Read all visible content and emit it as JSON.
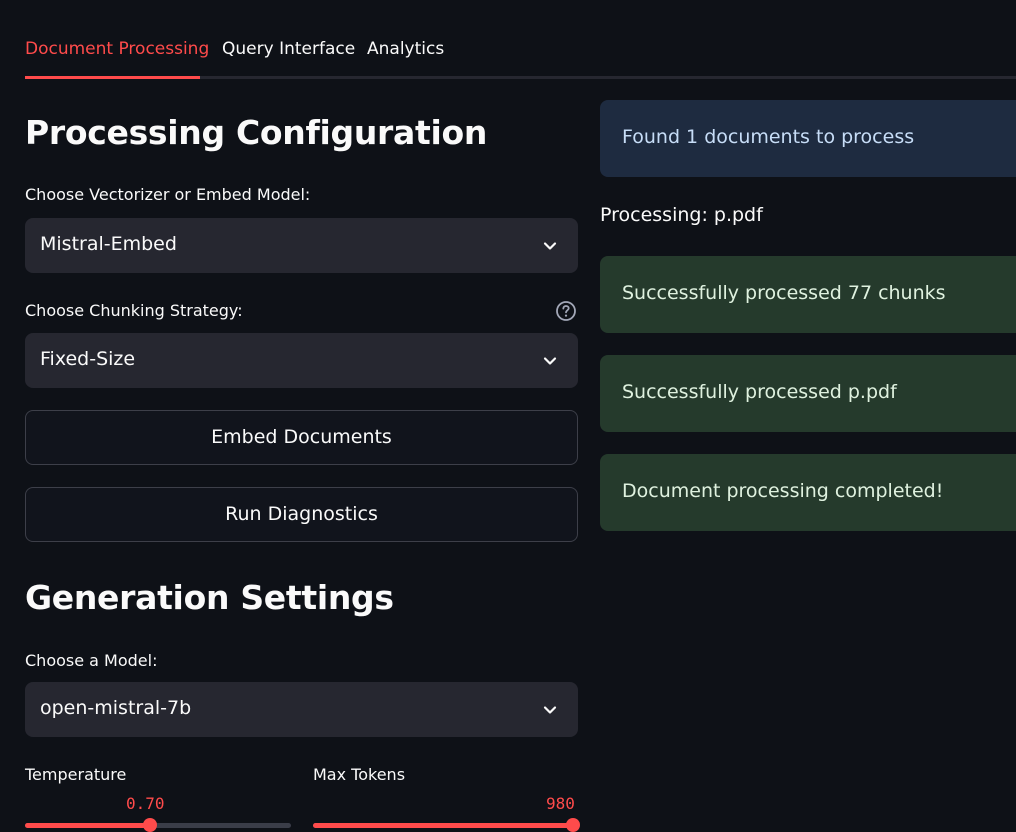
{
  "tabs": [
    {
      "label": "Document Processing",
      "active": true
    },
    {
      "label": "Query Interface",
      "active": false
    },
    {
      "label": "Analytics",
      "active": false
    }
  ],
  "processing": {
    "heading": "Processing Configuration",
    "vectorizer": {
      "label": "Choose Vectorizer or Embed Model:",
      "value": "Mistral-Embed"
    },
    "chunking": {
      "label": "Choose Chunking Strategy:",
      "value": "Fixed-Size"
    },
    "embed_button": "Embed Documents",
    "diagnostics_button": "Run Diagnostics"
  },
  "generation": {
    "heading": "Generation Settings",
    "model": {
      "label": "Choose a Model:",
      "value": "open-mistral-7b"
    },
    "temperature": {
      "label": "Temperature",
      "value": "0.70",
      "fraction": 0.47
    },
    "max_tokens": {
      "label": "Max Tokens",
      "value": "980",
      "fraction": 1.0
    }
  },
  "status": {
    "found": "Found 1 documents to process",
    "processing": "Processing: p.pdf",
    "chunks": "Successfully processed 77 chunks",
    "file": "Successfully processed p.pdf",
    "completed": "Document processing completed!"
  },
  "icons": {
    "chevron": "chevron-down-icon",
    "help": "help-circle-icon"
  },
  "colors": {
    "accent": "#ff4b4b",
    "background": "#0e1117",
    "info_bg": "#1e2b40",
    "success_bg": "#253a2c"
  }
}
